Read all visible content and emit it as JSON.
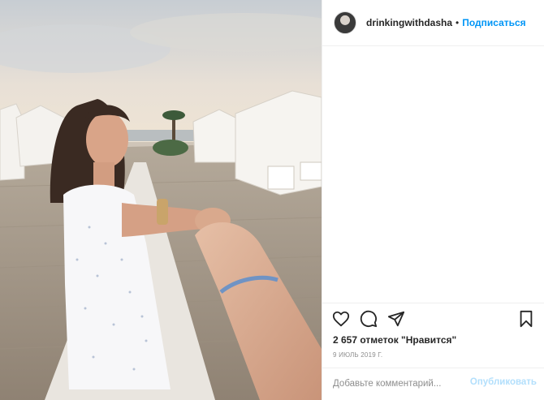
{
  "post": {
    "username": "drinkingwithdasha",
    "separator": "•",
    "follow_label": "Подписаться",
    "likes_text": "2 657 отметок \"Нравится\"",
    "date_text": "9 ИЮЛЬ 2019 Г.",
    "comment_placeholder": "Добавьте комментарий...",
    "publish_label": "Опубликовать"
  },
  "icons": {
    "like": "heart-icon",
    "comment": "speech-bubble-icon",
    "share": "paper-plane-icon",
    "save": "bookmark-icon"
  },
  "colors": {
    "accent": "#0095f6",
    "disabled_accent": "#b2dffc",
    "text": "#262626",
    "muted": "#8e8e8e",
    "border": "#efefef"
  }
}
